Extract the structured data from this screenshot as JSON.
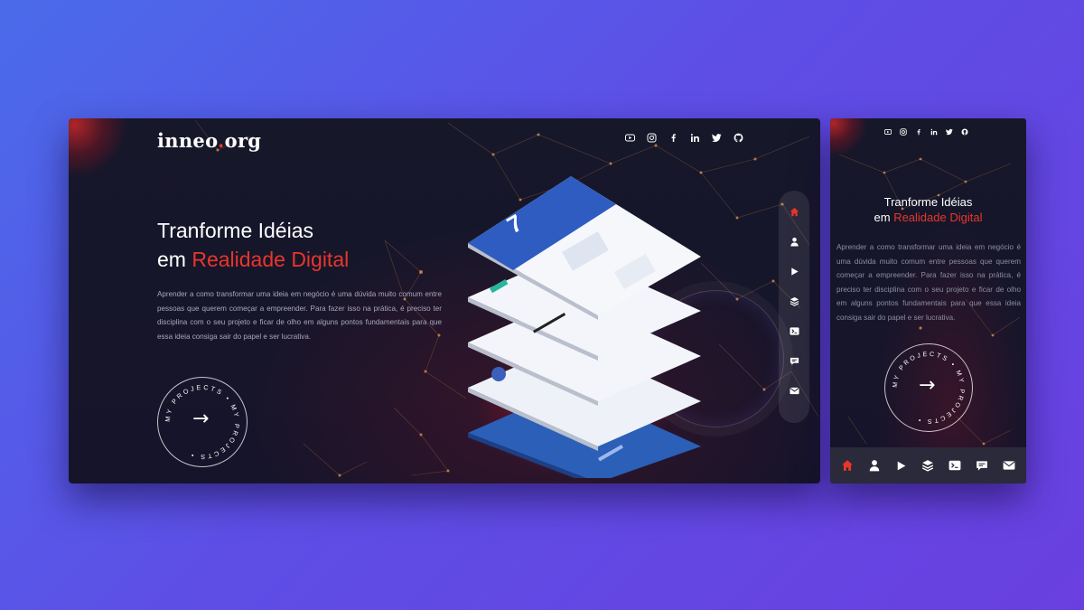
{
  "brand": {
    "name": "inneo",
    "dot": ".",
    "tld": "org"
  },
  "social_icons": [
    "youtube-icon",
    "instagram-icon",
    "facebook-icon",
    "linkedin-icon",
    "twitter-icon",
    "github-icon"
  ],
  "hero": {
    "title_line1": "Tranforme Idéias",
    "title_prefix": "em ",
    "title_accent": "Realidade Digital",
    "description": "Aprender a como transformar uma ideia em negócio é uma dúvida muito comum entre pessoas que querem começar a empreender. Para fazer isso na prática, é preciso ter disciplina com o seu projeto e ficar de olho em alguns pontos fundamentais para que essa ideia consiga sair do papel e ser lucrativa."
  },
  "projects_badge": {
    "text": "MY PROJECTS • MY PROJECTS •",
    "arrow": "→"
  },
  "nav_icons": [
    "home-icon",
    "user-icon",
    "play-icon",
    "layers-icon",
    "terminal-icon",
    "chat-icon",
    "mail-icon"
  ],
  "colors": {
    "accent": "#e8362a",
    "background": "#17172a",
    "page_gradient_start": "#4a6bea",
    "page_gradient_end": "#6a3fe0"
  }
}
